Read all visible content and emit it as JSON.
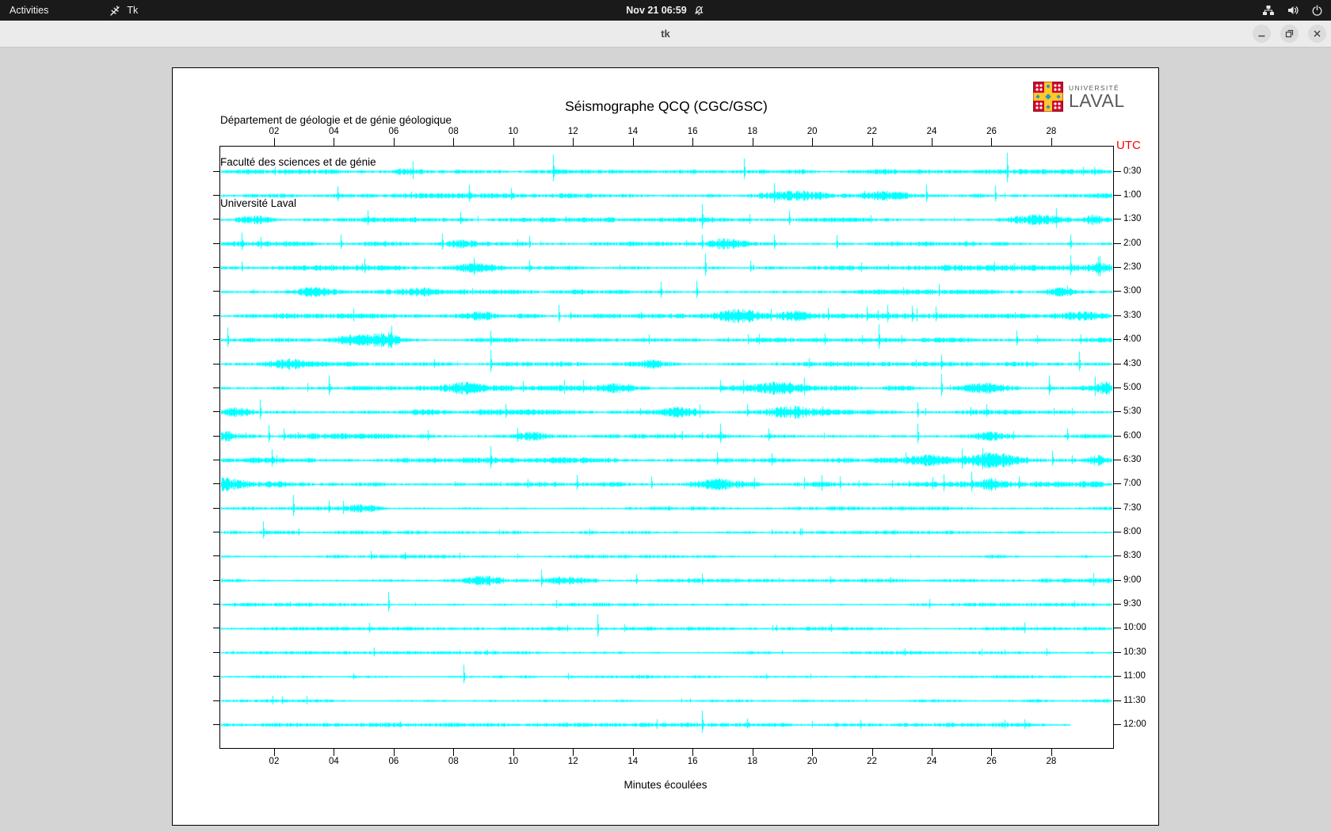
{
  "top_bar": {
    "activities_label": "Activities",
    "app_name": "Tk",
    "clock": "Nov 21 06:59"
  },
  "window": {
    "title": "tk"
  },
  "seismo": {
    "institution": [
      "Département de géologie et de génie géologique",
      "Faculté des sciences et de génie",
      "Université Laval"
    ],
    "title": "Séismographe QCQ (CGC/GSC)",
    "utc_label": "UTC",
    "xlabel": "Minutes écoulées",
    "logo": {
      "line1": "UNIVERSITÉ",
      "line2": "LAVAL"
    },
    "logo_colors": {
      "red": "#cf0a2c",
      "yellow": "#ffc72a",
      "blue": "#2196c9",
      "border": "#8a1420",
      "text": "#5a5a5c"
    }
  },
  "chart_data": {
    "type": "line",
    "subtype": "helicorder-seismogram",
    "station": "QCQ (CGC/GSC)",
    "title": "Séismographe QCQ (CGC/GSC)",
    "trace_color": "#00ffff",
    "grid": false,
    "x_axis": {
      "label": "Minutes écoulées",
      "min": 0,
      "max": 30,
      "tick_labels": [
        "02",
        "04",
        "06",
        "08",
        "10",
        "12",
        "14",
        "16",
        "18",
        "20",
        "22",
        "24",
        "26",
        "28"
      ]
    },
    "y_axis": {
      "label": "UTC",
      "position": "right",
      "tick_labels": [
        "0:30",
        "1:00",
        "1:30",
        "2:00",
        "2:30",
        "3:00",
        "3:30",
        "4:00",
        "4:30",
        "5:00",
        "5:30",
        "6:00",
        "6:30",
        "7:00",
        "7:30",
        "8:00",
        "8:30",
        "9:00",
        "9:30",
        "10:00",
        "10:30",
        "11:00",
        "11:30",
        "12:00"
      ]
    },
    "rows": [
      {
        "utc": "0:30",
        "length_min": 30,
        "noise": 1.8,
        "spikes": [
          [
            6.6,
            8
          ],
          [
            11.3,
            22
          ],
          [
            17.7,
            17
          ],
          [
            26.5,
            24
          ]
        ],
        "bursts": [
          [
            6.5,
            0.8,
            3
          ]
        ]
      },
      {
        "utc": "1:00",
        "length_min": 30,
        "noise": 1.9,
        "spikes": [
          [
            4.1,
            12
          ],
          [
            8.5,
            14
          ],
          [
            9.9,
            10
          ],
          [
            18.7,
            16
          ],
          [
            23.8,
            14
          ],
          [
            26.1,
            13
          ]
        ],
        "bursts": [
          [
            19.5,
            1.5,
            4
          ],
          [
            22.5,
            0.8,
            4
          ]
        ]
      },
      {
        "utc": "1:30",
        "length_min": 30,
        "noise": 1.8,
        "spikes": [
          [
            5.1,
            12
          ],
          [
            8.2,
            10
          ],
          [
            16.3,
            20
          ],
          [
            19.2,
            12
          ]
        ],
        "bursts": [
          [
            1.3,
            0.8,
            4
          ],
          [
            27.4,
            1.2,
            5
          ],
          [
            29.4,
            0.5,
            4
          ]
        ]
      },
      {
        "utc": "2:00",
        "length_min": 30,
        "noise": 2.0,
        "spikes": [
          [
            0.9,
            14
          ],
          [
            4.2,
            12
          ],
          [
            7.6,
            13
          ],
          [
            10.5,
            10
          ],
          [
            16.3,
            12
          ],
          [
            18.7,
            12
          ],
          [
            20.8,
            11
          ],
          [
            28.6,
            12
          ]
        ],
        "bursts": [
          [
            8.2,
            0.6,
            3
          ],
          [
            17.2,
            0.9,
            4
          ]
        ]
      },
      {
        "utc": "2:30",
        "length_min": 30,
        "noise": 2.1,
        "spikes": [
          [
            0.9,
            8
          ],
          [
            5.0,
            12
          ],
          [
            10.5,
            10
          ],
          [
            16.4,
            18
          ],
          [
            17.9,
            9
          ],
          [
            28.6,
            16
          ]
        ],
        "bursts": [
          [
            8.9,
            1.0,
            4
          ],
          [
            29.6,
            0.5,
            5
          ]
        ]
      },
      {
        "utc": "3:00",
        "length_min": 30,
        "noise": 1.9,
        "spikes": [
          [
            14.9,
            13
          ],
          [
            16.1,
            14
          ],
          [
            24.2,
            10
          ],
          [
            28.5,
            8
          ]
        ],
        "bursts": [
          [
            3.3,
            0.9,
            5
          ],
          [
            6.8,
            1.0,
            4
          ],
          [
            28.3,
            0.8,
            4
          ]
        ]
      },
      {
        "utc": "3:30",
        "length_min": 30,
        "noise": 1.9,
        "spikes": [
          [
            11.5,
            14
          ],
          [
            20.5,
            10
          ],
          [
            21.8,
            12
          ],
          [
            22.5,
            14
          ],
          [
            23.3,
            13
          ],
          [
            24.1,
            12
          ]
        ],
        "bursts": [
          [
            8.8,
            0.8,
            4
          ],
          [
            17.5,
            1.2,
            6
          ],
          [
            19.3,
            0.8,
            4
          ],
          [
            29.1,
            0.8,
            4
          ]
        ]
      },
      {
        "utc": "4:00",
        "length_min": 30,
        "noise": 1.8,
        "spikes": [
          [
            0.4,
            16
          ],
          [
            5.9,
            18
          ],
          [
            9.2,
            12
          ],
          [
            22.2,
            20
          ],
          [
            26.8,
            12
          ]
        ],
        "bursts": [
          [
            4.9,
            1.4,
            6
          ],
          [
            5.8,
            0.6,
            5
          ]
        ]
      },
      {
        "utc": "4:30",
        "length_min": 30,
        "noise": 1.8,
        "spikes": [
          [
            9.2,
            18
          ],
          [
            24.3,
            12
          ],
          [
            28.9,
            16
          ]
        ],
        "bursts": [
          [
            2.5,
            0.8,
            4
          ],
          [
            14.6,
            0.8,
            4
          ]
        ]
      },
      {
        "utc": "5:00",
        "length_min": 30,
        "noise": 2.2,
        "spikes": [
          [
            3.8,
            16
          ],
          [
            10.3,
            9
          ],
          [
            12.3,
            10
          ],
          [
            16.9,
            10
          ],
          [
            24.3,
            18
          ],
          [
            27.9,
            16
          ]
        ],
        "bursts": [
          [
            8.3,
            0.9,
            4
          ],
          [
            13.5,
            0.7,
            4
          ],
          [
            18.9,
            1.0,
            5
          ],
          [
            25.8,
            1.0,
            5
          ],
          [
            29.8,
            0.4,
            5
          ]
        ]
      },
      {
        "utc": "5:30",
        "length_min": 30,
        "noise": 2.1,
        "spikes": [
          [
            1.5,
            16
          ],
          [
            17.8,
            10
          ],
          [
            23.5,
            12
          ],
          [
            25.8,
            10
          ]
        ],
        "bursts": [
          [
            0.8,
            0.6,
            4
          ],
          [
            15.5,
            1.0,
            5
          ],
          [
            19.3,
            1.0,
            5
          ]
        ]
      },
      {
        "utc": "6:00",
        "length_min": 30,
        "noise": 2.2,
        "spikes": [
          [
            1.8,
            14
          ],
          [
            2.3,
            10
          ],
          [
            16.9,
            16
          ],
          [
            18.5,
            10
          ],
          [
            23.5,
            16
          ],
          [
            28.5,
            10
          ]
        ],
        "bursts": [
          [
            0.3,
            0.6,
            5
          ],
          [
            10.6,
            0.8,
            4
          ],
          [
            25.9,
            0.9,
            4
          ]
        ]
      },
      {
        "utc": "6:30",
        "length_min": 30,
        "noise": 2.2,
        "spikes": [
          [
            1.9,
            14
          ],
          [
            9.2,
            18
          ],
          [
            16.8,
            10
          ],
          [
            23.1,
            10
          ],
          [
            28.0,
            12
          ]
        ],
        "bursts": [
          [
            23.8,
            0.8,
            4
          ],
          [
            26.1,
            1.4,
            6
          ],
          [
            29.5,
            0.5,
            5
          ]
        ]
      },
      {
        "utc": "7:00",
        "length_min": 30,
        "noise": 2.3,
        "spikes": [
          [
            12.1,
            12
          ],
          [
            14.6,
            10
          ],
          [
            20.9,
            10
          ],
          [
            25.3,
            16
          ],
          [
            26.9,
            10
          ]
        ],
        "bursts": [
          [
            0.3,
            1.0,
            6
          ],
          [
            16.9,
            1.0,
            5
          ],
          [
            25.9,
            0.6,
            4
          ]
        ]
      },
      {
        "utc": "7:30",
        "length_min": 30,
        "noise": 1.5,
        "spikes": [
          [
            2.6,
            17
          ],
          [
            3.8,
            10
          ]
        ],
        "bursts": [
          [
            4.9,
            0.8,
            4
          ]
        ]
      },
      {
        "utc": "8:00",
        "length_min": 30,
        "noise": 1.4,
        "spikes": [
          [
            1.6,
            14
          ]
        ],
        "bursts": []
      },
      {
        "utc": "8:30",
        "length_min": 30,
        "noise": 1.3,
        "spikes": [
          [
            5.2,
            7
          ]
        ],
        "bursts": []
      },
      {
        "utc": "9:00",
        "length_min": 30,
        "noise": 1.7,
        "spikes": [
          [
            10.9,
            14
          ],
          [
            14.1,
            8
          ],
          [
            16.3,
            9
          ]
        ],
        "bursts": [
          [
            9.1,
            0.8,
            4
          ],
          [
            11.8,
            1.0,
            4
          ]
        ]
      },
      {
        "utc": "9:30",
        "length_min": 30,
        "noise": 1.3,
        "spikes": [
          [
            5.8,
            16
          ]
        ],
        "bursts": []
      },
      {
        "utc": "10:00",
        "length_min": 30,
        "noise": 1.3,
        "spikes": [
          [
            12.8,
            18
          ]
        ],
        "bursts": []
      },
      {
        "utc": "10:30",
        "length_min": 30,
        "noise": 1.2,
        "spikes": [],
        "bursts": []
      },
      {
        "utc": "11:00",
        "length_min": 30,
        "noise": 1.3,
        "spikes": [
          [
            8.3,
            15
          ]
        ],
        "bursts": []
      },
      {
        "utc": "11:30",
        "length_min": 30,
        "noise": 1.2,
        "spikes": [],
        "bursts": []
      },
      {
        "utc": "12:00",
        "length_min": 28.6,
        "noise": 1.5,
        "spikes": [
          [
            16.3,
            18
          ],
          [
            17.8,
            8
          ]
        ],
        "bursts": []
      }
    ]
  }
}
